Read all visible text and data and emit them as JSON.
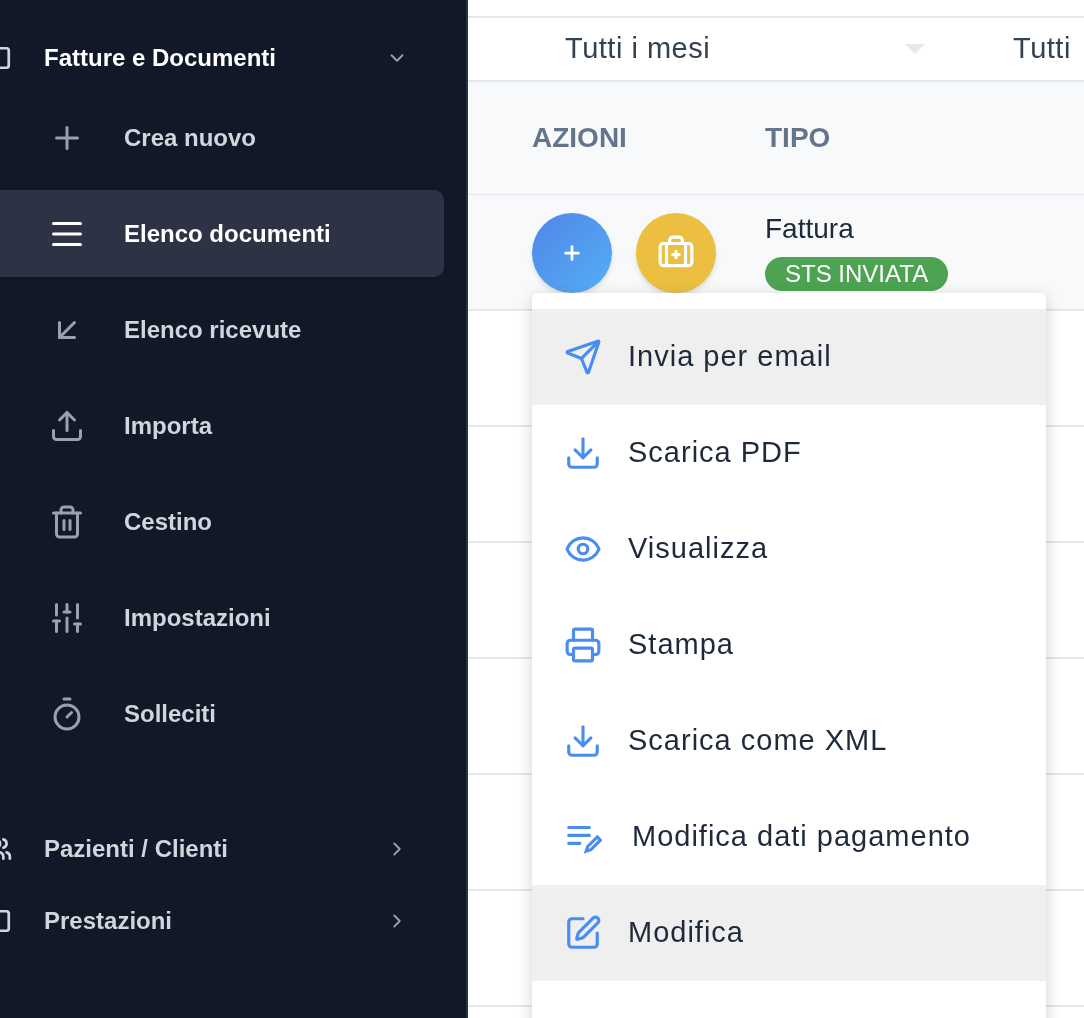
{
  "sidebar": {
    "groups": [
      {
        "label": "Fatture e Documenti",
        "expanded": true,
        "children": [
          {
            "label": "Crea nuovo",
            "selected": false
          },
          {
            "label": "Elenco documenti",
            "selected": true
          },
          {
            "label": "Elenco ricevute",
            "selected": false
          },
          {
            "label": "Importa",
            "selected": false
          },
          {
            "label": "Cestino",
            "selected": false
          },
          {
            "label": "Impostazioni",
            "selected": false
          },
          {
            "label": "Solleciti",
            "selected": false
          }
        ]
      },
      {
        "label": "Pazienti / Clienti",
        "expanded": false
      },
      {
        "label": "Prestazioni",
        "expanded": false
      }
    ]
  },
  "filters": [
    {
      "value": "Tutti i mesi"
    },
    {
      "value": "Tutti"
    }
  ],
  "table": {
    "columns": [
      "AZIONI",
      "TIPO"
    ],
    "rows": [
      {
        "type": "Fattura",
        "badge": "STS INVIATA"
      }
    ]
  },
  "menu": {
    "items": [
      {
        "label": "Invia per email",
        "highlighted": true
      },
      {
        "label": "Scarica PDF",
        "highlighted": false
      },
      {
        "label": "Visualizza",
        "highlighted": false
      },
      {
        "label": "Stampa",
        "highlighted": false
      },
      {
        "label": "Scarica come XML",
        "highlighted": false
      },
      {
        "label": "Modifica dati pagamento",
        "highlighted": false
      },
      {
        "label": "Modifica",
        "highlighted": true
      }
    ]
  }
}
